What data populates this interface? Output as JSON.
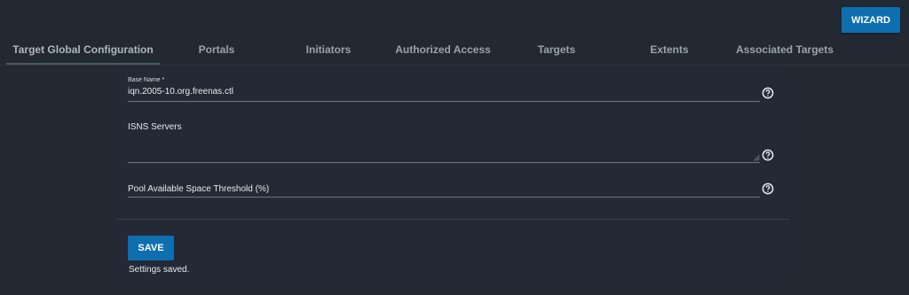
{
  "toolbar": {
    "wizard_label": "WIZARD"
  },
  "tabs": [
    {
      "label": "Target Global Configuration",
      "active": true
    },
    {
      "label": "Portals",
      "active": false
    },
    {
      "label": "Initiators",
      "active": false
    },
    {
      "label": "Authorized Access",
      "active": false
    },
    {
      "label": "Targets",
      "active": false
    },
    {
      "label": "Extents",
      "active": false
    },
    {
      "label": "Associated Targets",
      "active": false
    }
  ],
  "form": {
    "base_name": {
      "label": "Base Name *",
      "value": "iqn.2005-10.org.freenas.ctl"
    },
    "isns_servers": {
      "label": "ISNS Servers",
      "value": ""
    },
    "pool_threshold": {
      "label": "Pool Available Space Threshold (%)",
      "value": ""
    }
  },
  "actions": {
    "save_label": "SAVE"
  },
  "status": {
    "message": "Settings saved."
  },
  "colors": {
    "accent": "#0e6fb0",
    "background": "#222933"
  }
}
